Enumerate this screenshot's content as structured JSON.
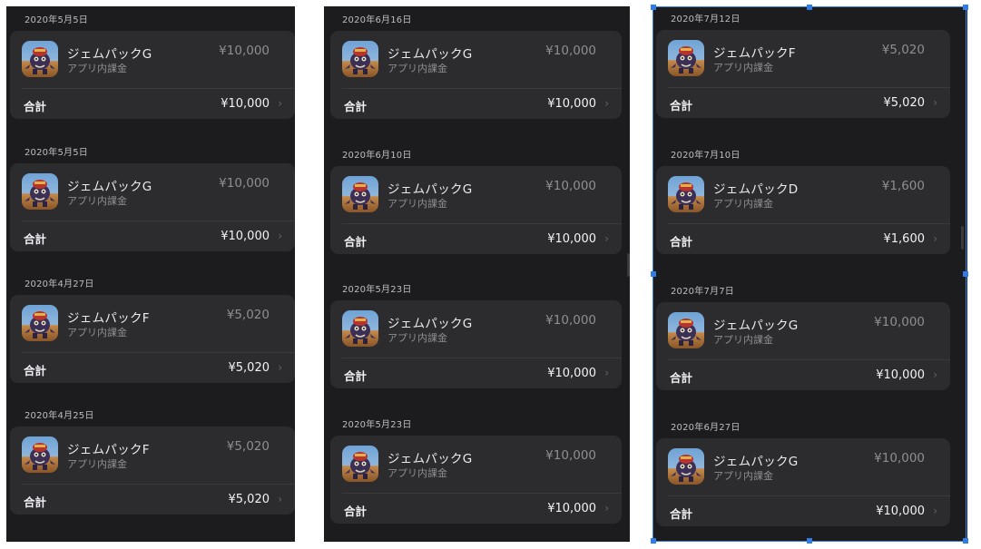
{
  "colors": {
    "panel_bg": "#1c1c1e",
    "card_bg": "#2c2c2e",
    "selection": "#3d7fe8"
  },
  "icons": {
    "app": "game-character-app-icon",
    "chevron": "chevron-right-icon"
  },
  "panels": [
    {
      "purchases": [
        {
          "date": "2020年5月5日",
          "item_name": "ジェムパックG",
          "item_type": "アプリ内課金",
          "price": "¥10,000",
          "total_label": "合計",
          "total": "¥10,000",
          "chevron": "›"
        },
        {
          "date": "2020年5月5日",
          "item_name": "ジェムパックG",
          "item_type": "アプリ内課金",
          "price": "¥10,000",
          "total_label": "合計",
          "total": "¥10,000",
          "chevron": "›"
        },
        {
          "date": "2020年4月27日",
          "item_name": "ジェムパックF",
          "item_type": "アプリ内課金",
          "price": "¥5,020",
          "total_label": "合計",
          "total": "¥5,020",
          "chevron": "›"
        },
        {
          "date": "2020年4月25日",
          "item_name": "ジェムパックF",
          "item_type": "アプリ内課金",
          "price": "¥5,020",
          "total_label": "合計",
          "total": "¥5,020",
          "chevron": "›"
        }
      ]
    },
    {
      "purchases": [
        {
          "date": "2020年6月16日",
          "item_name": "ジェムパックG",
          "item_type": "アプリ内課金",
          "price": "¥10,000",
          "total_label": "合計",
          "total": "¥10,000",
          "chevron": "›"
        },
        {
          "date": "2020年6月10日",
          "item_name": "ジェムパックG",
          "item_type": "アプリ内課金",
          "price": "¥10,000",
          "total_label": "合計",
          "total": "¥10,000",
          "chevron": "›"
        },
        {
          "date": "2020年5月23日",
          "item_name": "ジェムパックG",
          "item_type": "アプリ内課金",
          "price": "¥10,000",
          "total_label": "合計",
          "total": "¥10,000",
          "chevron": "›"
        },
        {
          "date": "2020年5月23日",
          "item_name": "ジェムパックG",
          "item_type": "アプリ内課金",
          "price": "¥10,000",
          "total_label": "合計",
          "total": "¥10,000",
          "chevron": "›"
        }
      ]
    },
    {
      "selected": true,
      "purchases": [
        {
          "date": "2020年7月12日",
          "item_name": "ジェムパックF",
          "item_type": "アプリ内課金",
          "price": "¥5,020",
          "total_label": "合計",
          "total": "¥5,020",
          "chevron": "›"
        },
        {
          "date": "2020年7月10日",
          "item_name": "ジェムパックD",
          "item_type": "アプリ内課金",
          "price": "¥1,600",
          "total_label": "合計",
          "total": "¥1,600",
          "chevron": "›"
        },
        {
          "date": "2020年7月7日",
          "item_name": "ジェムパックG",
          "item_type": "アプリ内課金",
          "price": "¥10,000",
          "total_label": "合計",
          "total": "¥10,000",
          "chevron": "›"
        },
        {
          "date": "2020年6月27日",
          "item_name": "ジェムパックG",
          "item_type": "アプリ内課金",
          "price": "¥10,000",
          "total_label": "合計",
          "total": "¥10,000",
          "chevron": "›"
        }
      ]
    }
  ]
}
